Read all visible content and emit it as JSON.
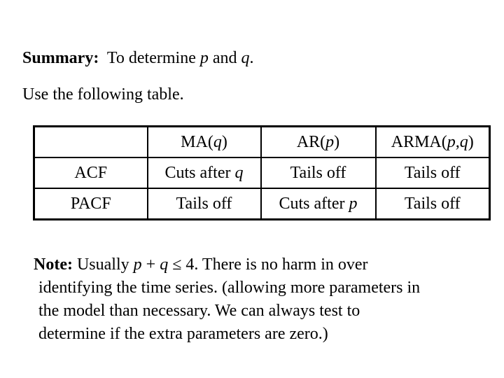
{
  "summary": {
    "label": "Summary:",
    "text_before": "To determine ",
    "var_p": "p",
    "text_and": " and ",
    "var_q": "q",
    "text_end": "."
  },
  "intro": "Use the following table.",
  "table": {
    "headers": [
      {
        "prefix": "",
        "var": "",
        "suffix": ""
      },
      {
        "prefix": "MA(",
        "var": "q",
        "suffix": ")"
      },
      {
        "prefix": "AR(",
        "var": "p",
        "suffix": ")"
      },
      {
        "prefix": "ARMA(",
        "var": "p,q",
        "suffix": ")"
      }
    ],
    "rows": [
      {
        "label": "ACF",
        "cells": [
          {
            "text": "Cuts after ",
            "var": "q"
          },
          {
            "text": "Tails off",
            "var": ""
          },
          {
            "text": "Tails off",
            "var": ""
          }
        ]
      },
      {
        "label": "PACF",
        "cells": [
          {
            "text": "Tails off",
            "var": ""
          },
          {
            "text": "Cuts after ",
            "var": "p"
          },
          {
            "text": "Tails off",
            "var": ""
          }
        ]
      }
    ]
  },
  "note": {
    "label": "Note:",
    "line1_a": " Usually ",
    "line1_p": "p",
    "line1_plus": " + ",
    "line1_q": "q",
    "line1_b": " ≤ 4. There is no harm in over",
    "line2": "identifying the time series. (allowing more parameters in",
    "line3": "the model than necessary. We can always test to",
    "line4": "determine if the extra parameters are zero.)"
  }
}
